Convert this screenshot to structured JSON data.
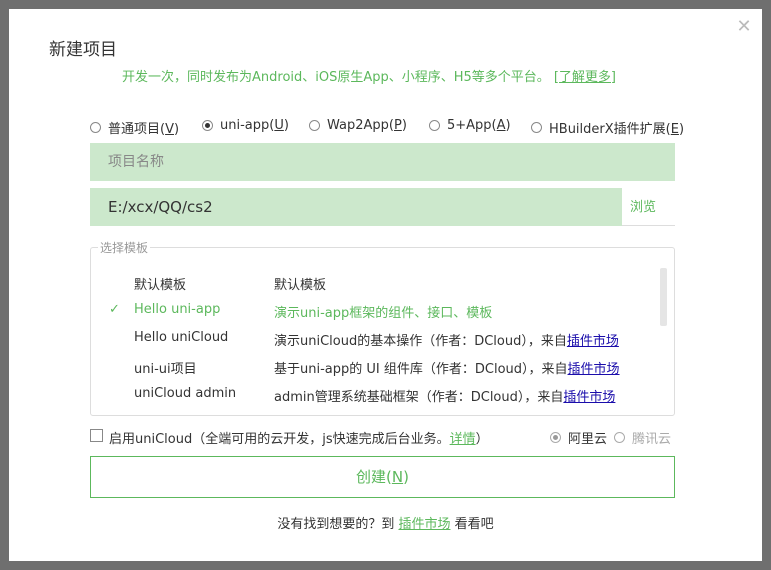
{
  "dialog": {
    "title": "新建项目",
    "subtitle": "开发一次，同时发布为Android、iOS原生App、小程序、H5等多个平台。",
    "learn_more": "[了解更多]"
  },
  "project_types": [
    {
      "label": "普通项目(",
      "key": "V",
      "selected": false
    },
    {
      "label": "uni-app(",
      "key": "U",
      "selected": true
    },
    {
      "label": "Wap2App(",
      "key": "P",
      "selected": false
    },
    {
      "label": "5+App(",
      "key": "A",
      "selected": false
    },
    {
      "label": "HBuilderX插件扩展(",
      "key": "E",
      "selected": false
    }
  ],
  "project_name": {
    "placeholder": "项目名称",
    "value": ""
  },
  "project_path": {
    "value": "E:/xcx/QQ/cs2",
    "browse_label": "浏览"
  },
  "templates": {
    "legend": "选择模板",
    "items": [
      {
        "name": "默认模板",
        "desc": "默认模板",
        "selected": false
      },
      {
        "name": "Hello uni-app",
        "desc": "演示uni-app框架的组件、接口、模板",
        "selected": true
      },
      {
        "name": "Hello uniCloud",
        "desc": "演示uniCloud的基本操作（作者：DCloud），来自",
        "link": "插件市场",
        "selected": false
      },
      {
        "name": "uni-ui项目",
        "desc": "基于uni-app的 UI 组件库（作者：DCloud），来自",
        "link": "插件市场",
        "selected": false
      },
      {
        "name": "uniCloud admin",
        "desc": "admin管理系统基础框架（作者：DCloud），来自",
        "link": "插件市场",
        "selected": false
      }
    ]
  },
  "unicloud": {
    "label": "启用uniCloud（全端可用的云开发，js快速完成后台业务。",
    "detail": "详情",
    "label_end": "）",
    "providers": [
      {
        "label": "阿里云",
        "selected": true,
        "enabled": true
      },
      {
        "label": "腾讯云",
        "selected": false,
        "enabled": false
      }
    ]
  },
  "create_button": {
    "label": "创建(",
    "key": "N",
    "label_end": ")"
  },
  "footer": {
    "text": "没有找到想要的？到",
    "link": "插件市场",
    "text_end": "看看吧"
  },
  "colors": {
    "accent": "#5cb85c",
    "field_bg": "#cce8cc",
    "link": "#1a0dab"
  }
}
